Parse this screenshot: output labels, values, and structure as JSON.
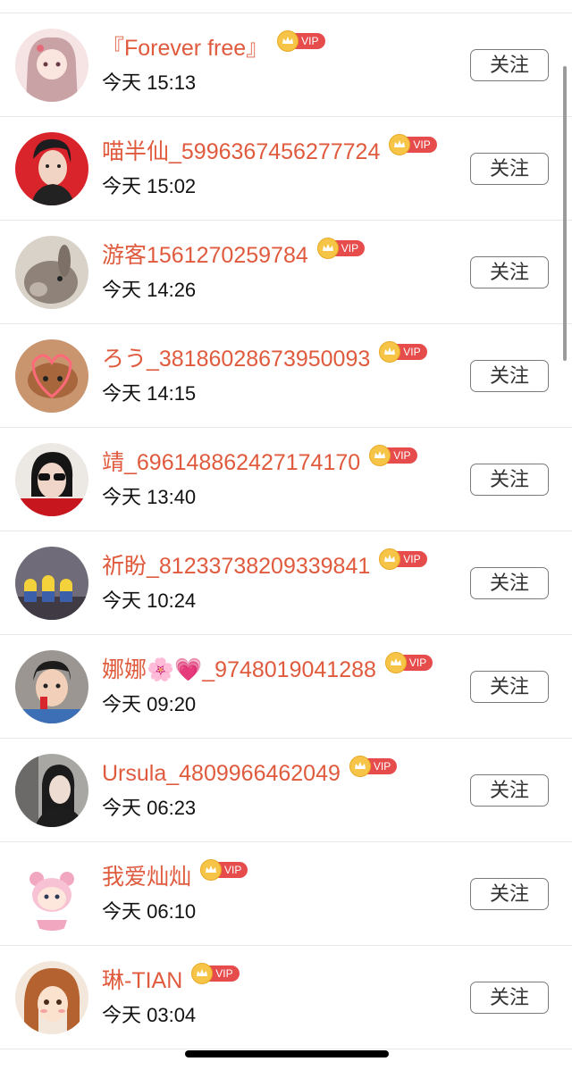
{
  "follow_label": "关注",
  "vip_label": "VIP",
  "colors": {
    "username": "#e05a3d",
    "vip_badge": "#e64c4c",
    "vip_crown": "#f6c548"
  },
  "users": [
    {
      "name": "『Forever free』",
      "time": "今天 15:13",
      "avatar": "anime-girl-pink-avatar"
    },
    {
      "name": "喵半仙_5996367456277724",
      "time": "今天 15:02",
      "avatar": "anime-man-red-avatar"
    },
    {
      "name": "游客1561270259784",
      "time": "今天 14:26",
      "avatar": "rabbit-photo-avatar"
    },
    {
      "name": "ろう_38186028673950093",
      "time": "今天 14:15",
      "avatar": "cat-heart-photo-avatar"
    },
    {
      "name": "靖_6961488624271741​70",
      "time": "今天 13:40",
      "avatar": "sunglasses-woman-avatar"
    },
    {
      "name": "祈盼_81233738209339841",
      "time": "今天 10:24",
      "avatar": "minions-avatar"
    },
    {
      "name": "娜娜🌸💗_9748019041288",
      "time": "今天 09:20",
      "avatar": "child-photo-avatar"
    },
    {
      "name": "Ursula_4809966462049",
      "time": "今天 06:23",
      "avatar": "woman-photo-avatar"
    },
    {
      "name": "我爱灿灿",
      "time": "今天 06:10",
      "avatar": "cartoon-pink-bear-avatar"
    },
    {
      "name": "琳-TIAN",
      "time": "今天 03:04",
      "avatar": "anime-girl-brown-hair-avatar"
    }
  ]
}
